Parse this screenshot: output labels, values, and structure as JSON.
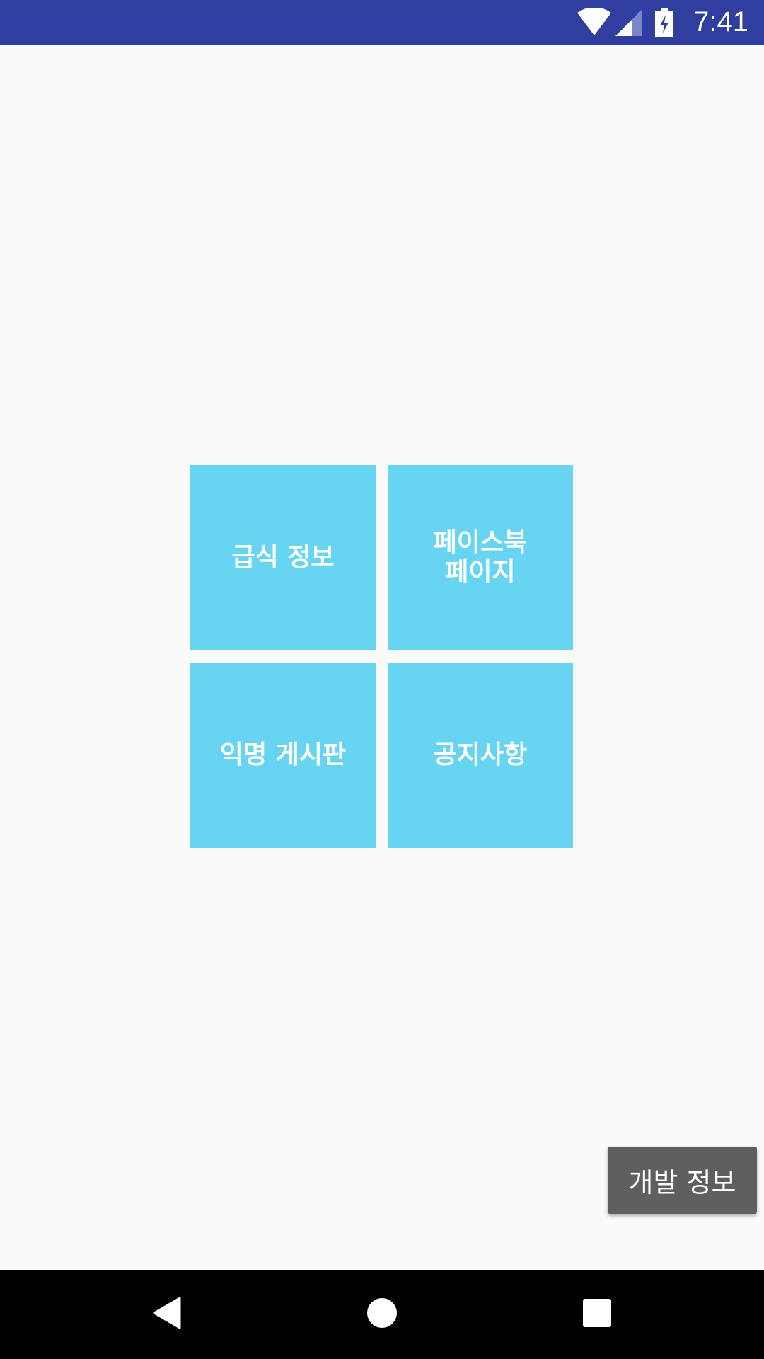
{
  "status_bar": {
    "time": "7:41",
    "background_color": "#303f9f",
    "icons": [
      "wifi-icon",
      "cell-signal-icon",
      "battery-charging-icon"
    ]
  },
  "menu": {
    "tile_color": "#67d4f2",
    "tiles": [
      {
        "label": "급식 정보"
      },
      {
        "label": "페이스북\n페이지"
      },
      {
        "label": "익명 게시판"
      },
      {
        "label": "공지사항"
      }
    ]
  },
  "dev_info_button": {
    "label": "개발 정보"
  },
  "nav_bar": {
    "icons": [
      "back-icon",
      "home-icon",
      "recents-icon"
    ]
  }
}
